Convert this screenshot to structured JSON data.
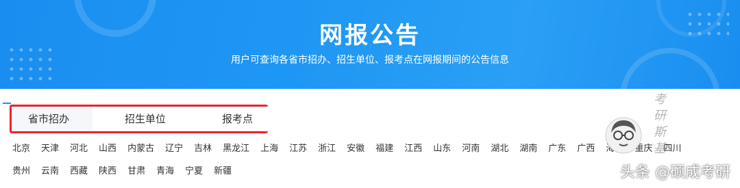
{
  "banner": {
    "title": "网报公告",
    "subtitle": "用户可查询各省市招办、招生单位、报考点在网报期间的公告信息"
  },
  "tabs": [
    {
      "label": "省市招办"
    },
    {
      "label": "招生单位"
    },
    {
      "label": "报考点"
    }
  ],
  "provinces_row1": [
    "北京",
    "天津",
    "河北",
    "山西",
    "内蒙古",
    "辽宁",
    "吉林",
    "黑龙江",
    "上海",
    "江苏",
    "浙江",
    "安徽",
    "福建",
    "江西",
    "山东",
    "河南",
    "湖北",
    "湖南",
    "广东",
    "广西",
    "海南",
    "重庆",
    "四川"
  ],
  "provinces_row2": [
    "贵州",
    "云南",
    "西藏",
    "陕西",
    "甘肃",
    "青海",
    "宁夏",
    "新疆"
  ],
  "watermark": {
    "vertical": "考研斯基",
    "credit": "头条 @硕成考研"
  },
  "colors": {
    "banner_blue": "#1a8ef0",
    "highlight_red": "#e8232e"
  }
}
